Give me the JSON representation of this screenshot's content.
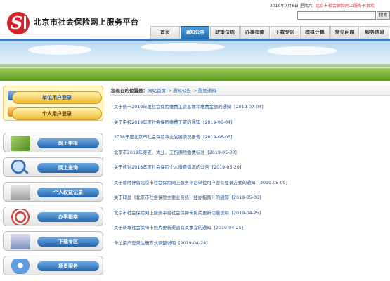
{
  "header": {
    "site_title": "北京市社会保险网上服务平台",
    "date_text": "2019年7月6日 星期六",
    "scroll_text": "北京市社会保险网上服务平台欢",
    "search_button": "搜索"
  },
  "nav": {
    "items": [
      {
        "label": "首页",
        "active": false
      },
      {
        "label": "通知公告",
        "active": true
      },
      {
        "label": "政策法规",
        "active": false
      },
      {
        "label": "办事指南",
        "active": false
      },
      {
        "label": "下载专区",
        "active": false
      },
      {
        "label": "模拟计算",
        "active": false
      },
      {
        "label": "常见问题",
        "active": false
      },
      {
        "label": "服务信息",
        "active": false
      }
    ]
  },
  "sidebar": {
    "login": {
      "unit_label": "单位用户登录",
      "personal_label": "个人用户登录"
    },
    "items": [
      {
        "label": "网上申报",
        "icon": "report-icon"
      },
      {
        "label": "网上查询",
        "icon": "search-magnifier-icon"
      },
      {
        "label": "个人权益记录",
        "icon": "rights-record-icon"
      },
      {
        "label": "办事指南",
        "icon": "guide-icon"
      },
      {
        "label": "下载专区",
        "icon": "download-icon"
      },
      {
        "label": "场景服务",
        "icon": "service-icon"
      }
    ]
  },
  "breadcrumb": {
    "label": "您现在的位置是：",
    "home": "网站首页",
    "section": "通知公告",
    "current": "重要通知",
    "sep": "->"
  },
  "news": [
    {
      "title": "关于统一2019年度社会保险缴费工资基数和缴费金额的通知",
      "date": "[2019-07-04]"
    },
    {
      "title": "关于申报2019年度社会保险缴费工资的通知",
      "date": "[2019-06-04]"
    },
    {
      "title": "2018年度北京市社会保险事业发展情况报告",
      "date": "[2019-06-03]"
    },
    {
      "title": "北京市2019年养老、失业、工伤保险缴费标准",
      "date": "[2019-05-30]"
    },
    {
      "title": "关于核对2018年度社会保险个人缴费情况的公告",
      "date": "[2019-05-20]"
    },
    {
      "title": "关于暂时停留北京市社会保险网上服务平台单位用户密有登录方式的通知",
      "date": "[2019-05-09]"
    },
    {
      "title": "关于印发《北京市社会保险主要业务统一经办指南》的通知",
      "date": "[2019-05-06]"
    },
    {
      "title": "北京市社会保险网上服务平台社会保障卡照片更新功能说明",
      "date": "[2019-04-25]"
    },
    {
      "title": "关于新增社会保障卡照片更新渠道有关事宜的通知",
      "date": "[2019-04-25]"
    },
    {
      "title": "单位用户登录注册方式调整说明",
      "date": "[2019-04-24]"
    }
  ]
}
